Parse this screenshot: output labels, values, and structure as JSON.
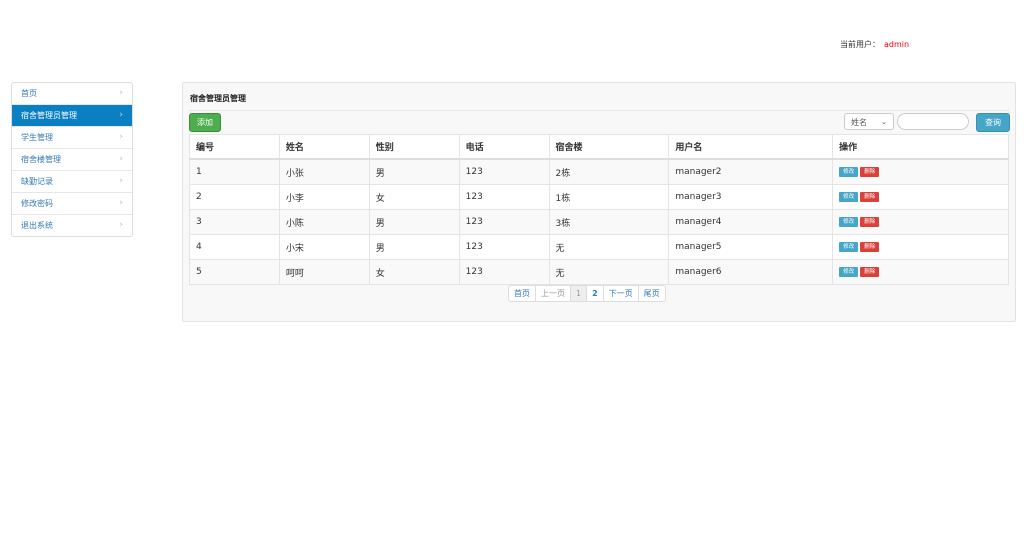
{
  "user": {
    "label": "当前用户：",
    "name": "admin"
  },
  "sidebar": {
    "items": [
      {
        "label": "首页",
        "active": false
      },
      {
        "label": "宿舍管理员管理",
        "active": true
      },
      {
        "label": "学生管理",
        "active": false
      },
      {
        "label": "宿舍楼管理",
        "active": false
      },
      {
        "label": "缺勤记录",
        "active": false
      },
      {
        "label": "修改密码",
        "active": false
      },
      {
        "label": "退出系统",
        "active": false
      }
    ],
    "chevron": "›"
  },
  "panel": {
    "title": "宿舍管理员管理",
    "add_label": "添加",
    "search": {
      "field_selected": "姓名",
      "value": "",
      "query_label": "查询"
    }
  },
  "table": {
    "headers": [
      "编号",
      "姓名",
      "性别",
      "电话",
      "宿舍楼",
      "用户名",
      "操作"
    ],
    "rows": [
      [
        "1",
        "小张",
        "男",
        "123",
        "2栋",
        "manager2"
      ],
      [
        "2",
        "小李",
        "女",
        "123",
        "1栋",
        "manager3"
      ],
      [
        "3",
        "小陈",
        "男",
        "123",
        "3栋",
        "manager4"
      ],
      [
        "4",
        "小宋",
        "男",
        "123",
        "无",
        "manager5"
      ],
      [
        "5",
        "呵呵",
        "女",
        "123",
        "无",
        "manager6"
      ]
    ],
    "edit_label": "修改",
    "delete_label": "删除"
  },
  "pagination": {
    "first": "首页",
    "prev": "上一页",
    "pages": [
      "1",
      "2"
    ],
    "current": "1",
    "next": "下一页",
    "last": "尾页"
  },
  "colors": {
    "accent": "#0a7fc2",
    "add": "#4cae4c",
    "edit": "#46a6c8",
    "delete": "#d9413b",
    "username": "#e60012"
  }
}
